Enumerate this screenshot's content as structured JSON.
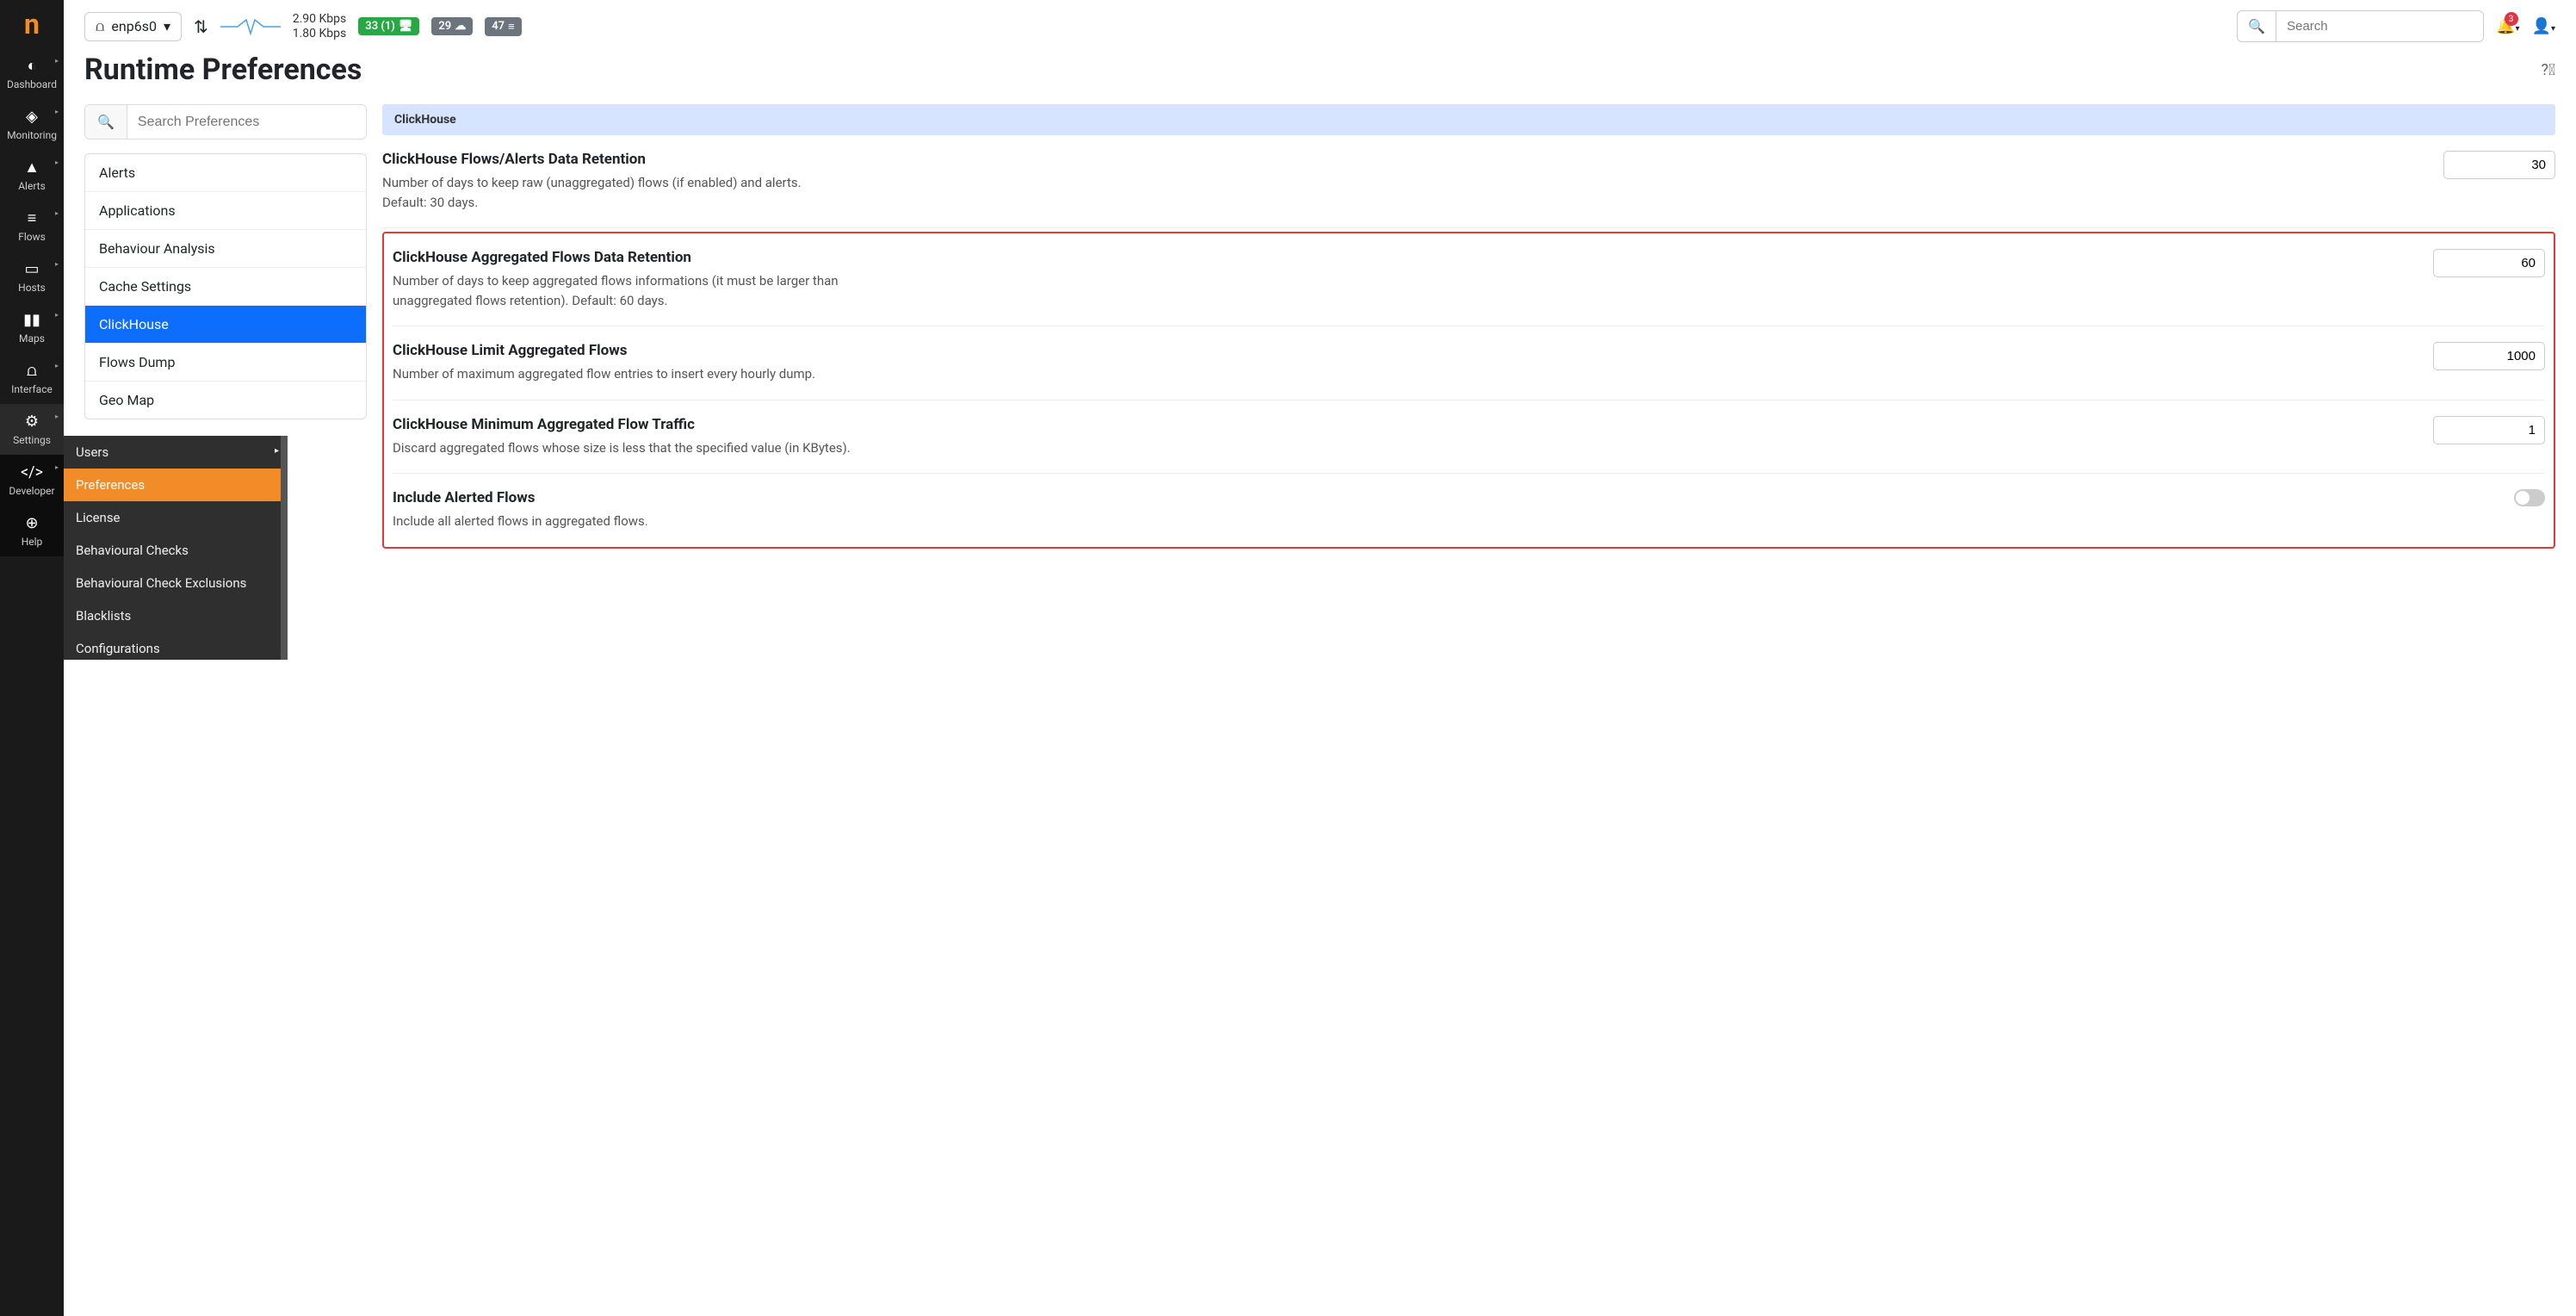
{
  "logo": "n",
  "sidebar": [
    {
      "icon": "◐",
      "label": "Dashboard"
    },
    {
      "icon": "◈",
      "label": "Monitoring"
    },
    {
      "icon": "▲",
      "label": "Alerts"
    },
    {
      "icon": "≡",
      "label": "Flows"
    },
    {
      "icon": "▭",
      "label": "Hosts"
    },
    {
      "icon": "▮▮",
      "label": "Maps"
    },
    {
      "icon": "⩍",
      "label": "Interface"
    },
    {
      "icon": "⚙",
      "label": "Settings"
    },
    {
      "icon": "</>",
      "label": "Developer"
    },
    {
      "icon": "⊕",
      "label": "Help"
    }
  ],
  "submenu": [
    {
      "label": "Users",
      "has_sub": true
    },
    {
      "label": "Preferences",
      "active": true
    },
    {
      "label": "License"
    },
    {
      "label": "Behavioural Checks"
    },
    {
      "label": "Behavioural Check Exclusions"
    },
    {
      "label": "Blacklists"
    },
    {
      "label": "Configurations"
    }
  ],
  "topbar": {
    "iface": "enp6s0",
    "rate_down": "2.90 Kbps",
    "rate_up": "1.80 Kbps",
    "badge1": "33 (1)",
    "badge2": "29",
    "badge3": "47",
    "search_placeholder": "Search",
    "notif_count": "3"
  },
  "page_title": "Runtime Preferences",
  "pref_search_placeholder": "Search Preferences",
  "categories": [
    "Alerts",
    "Applications",
    "Behaviour Analysis",
    "Cache Settings",
    "ClickHouse",
    "Flows Dump",
    "Geo Map"
  ],
  "active_category": "ClickHouse",
  "section_title": "ClickHouse",
  "prefs": [
    {
      "title": "ClickHouse Flows/Alerts Data Retention",
      "desc": "Number of days to keep raw (unaggregated) flows (if enabled) and alerts. Default: 30 days.",
      "value": "30",
      "type": "text"
    },
    {
      "title": "ClickHouse Aggregated Flows Data Retention",
      "desc": "Number of days to keep aggregated flows informations (it must be larger than unaggregated flows retention). Default: 60 days.",
      "value": "60",
      "type": "text"
    },
    {
      "title": "ClickHouse Limit Aggregated Flows",
      "desc": "Number of maximum aggregated flow entries to insert every hourly dump.",
      "value": "1000",
      "type": "text"
    },
    {
      "title": "ClickHouse Minimum Aggregated Flow Traffic",
      "desc": "Discard aggregated flows whose size is less that the specified value (in KBytes).",
      "value": "1",
      "type": "text"
    },
    {
      "title": "Include Alerted Flows",
      "desc": "Include all alerted flows in aggregated flows.",
      "value": "off",
      "type": "toggle"
    }
  ]
}
